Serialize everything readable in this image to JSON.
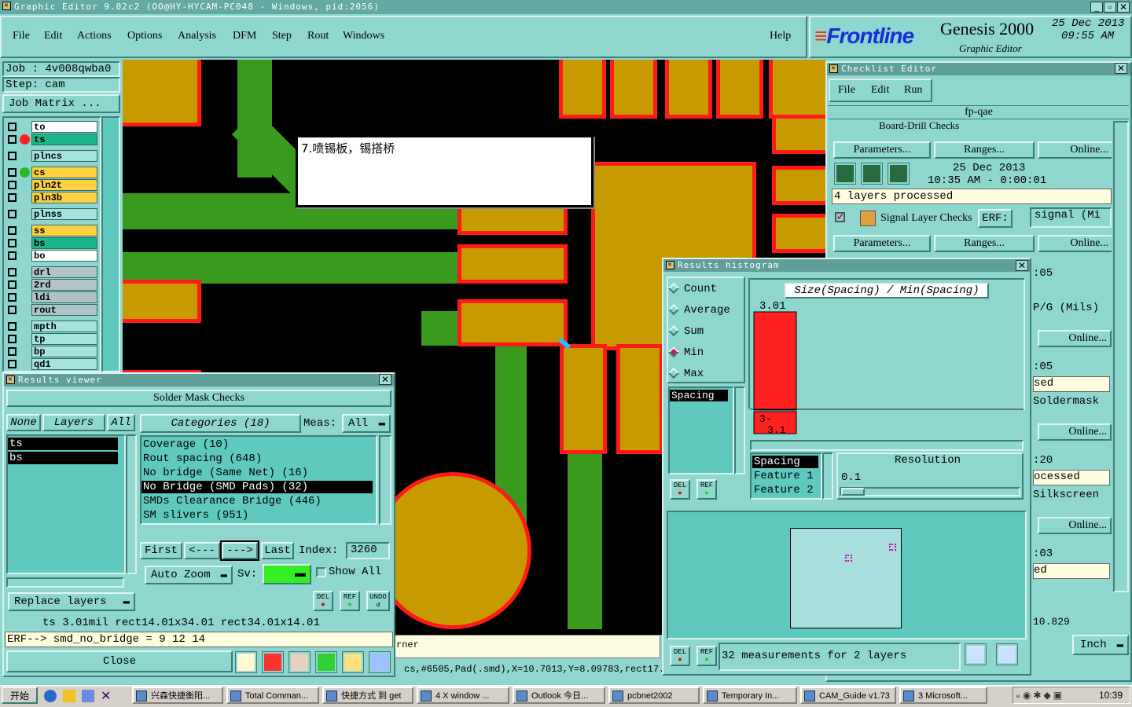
{
  "window": {
    "title": "Graphic Editor 9.02c2  (OO@HY-HYCAM-PC048 - Windows, pid:2056)"
  },
  "menubar": {
    "items": [
      "File",
      "Edit",
      "Actions",
      "Options",
      "Analysis",
      "DFM",
      "Step",
      "Rout",
      "Windows"
    ],
    "help": "Help"
  },
  "brand": {
    "logo": "Frontline",
    "product": "Genesis 2000",
    "subtitle": "Graphic Editor",
    "date": "25 Dec 2013",
    "time": "09:55 AM"
  },
  "job": {
    "job": "Job  :  4v008qwba0",
    "step": "Step:  cam",
    "matrix_button": "Job Matrix ..."
  },
  "layers": [
    {
      "name": "to",
      "style": "w",
      "dot": ""
    },
    {
      "name": "ts",
      "style": "g",
      "dot": "#ff2020"
    },
    {
      "name": "plncs",
      "style": "c",
      "dot": ""
    },
    {
      "name": "cs",
      "style": "y",
      "dot": "#28b828"
    },
    {
      "name": "pln2t",
      "style": "y",
      "dot": ""
    },
    {
      "name": "pln3b",
      "style": "y",
      "dot": ""
    },
    {
      "name": "plnss",
      "style": "c",
      "dot": ""
    },
    {
      "name": "ss",
      "style": "y",
      "dot": ""
    },
    {
      "name": "bs",
      "style": "g",
      "dot": ""
    },
    {
      "name": "bo",
      "style": "w",
      "dot": ""
    },
    {
      "name": "drl",
      "style": "s",
      "dot": ""
    },
    {
      "name": "2rd",
      "style": "s",
      "dot": ""
    },
    {
      "name": "ldi",
      "style": "s",
      "dot": ""
    },
    {
      "name": "rout",
      "style": "s",
      "dot": ""
    },
    {
      "name": "mpth",
      "style": "c",
      "dot": ""
    },
    {
      "name": "tp",
      "style": "c",
      "dot": ""
    },
    {
      "name": "bp",
      "style": "c",
      "dot": ""
    },
    {
      "name": "qd1",
      "style": "c",
      "dot": ""
    }
  ],
  "annotation": {
    "text": "7.喷锡板，锡搭桥"
  },
  "status_coords": "cs,#6505,Pad(.smd),X=10.7013,Y=8.09783,rect17.",
  "status_left": "rner",
  "results_viewer": {
    "title": "Results viewer",
    "header": "Solder Mask Checks",
    "none": "None",
    "layers_label": "Layers",
    "all": "All",
    "layer_items": [
      "ts",
      "bs"
    ],
    "categories_label": "Categories (18)",
    "meas_label": "Meas:",
    "meas_value": "All",
    "categories": [
      "Coverage (10)",
      "Rout spacing (648)",
      "No bridge (Same Net) (16)",
      "No Bridge (SMD Pads) (32)",
      "SMDs Clearance Bridge (446)",
      "SM slivers (951)"
    ],
    "selected_category": 3,
    "first": "First",
    "prev": "<---",
    "next": "--->",
    "last": "Last",
    "index_label": "Index:",
    "index_value": "3260",
    "auto_zoom": "Auto Zoom",
    "sv_label": "Sv:",
    "show_all": "Show All",
    "replace_layers": "Replace layers",
    "del": "DEL",
    "ref": "REF",
    "undo": "UNDO",
    "info1": "ts 3.01mil   rect14.01x34.01   rect34.01x14.01",
    "info2": "ERF--> smd_no_bridge = 9 12 14",
    "close": "Close"
  },
  "checklist": {
    "title": "Checklist Editor",
    "menu": [
      "File",
      "Edit",
      "Run"
    ],
    "name": "fp-qae",
    "row0": "Board-Drill Checks",
    "erf": "ERF:",
    "params": "Parameters...",
    "ranges": "Ranges...",
    "online": "Online...",
    "date": "25 Dec 2013",
    "time": "10:35 AM - 0:00:01",
    "processed": "4 layers processed",
    "signal_row": "Signal Layer Checks",
    "signal_val": "signal (Mi",
    "side_items": [
      ":05",
      "P/G (Mils)",
      ":05",
      "sed",
      "Soldermask",
      ":20",
      "ocessed",
      "Silkscreen",
      ":03",
      "ed"
    ],
    "bottom_val": "10.829250",
    "units": "Inch"
  },
  "histogram": {
    "title": "Results histogram",
    "options": [
      "Count",
      "Average",
      "Sum",
      "Min",
      "Max"
    ],
    "selected": "Min",
    "chart_title": "Size(Spacing) / Min(Spacing)",
    "bar_value": "3.01",
    "bar_label": "3-\n3.1",
    "list": [
      "Spacing"
    ],
    "feature_list": [
      "Spacing",
      "Feature 1",
      "Feature 2"
    ],
    "resolution_label": "Resolution",
    "resolution_value": "0.1",
    "footer": "32 measurements for 2 layers"
  },
  "chart_data": {
    "type": "bar",
    "title": "Size(Spacing) / Min(Spacing)",
    "categories": [
      "3-3.1"
    ],
    "values": [
      3.01
    ]
  },
  "taskbar": {
    "start": "开始",
    "items": [
      "兴森快捷衡阳...",
      "Total Comman...",
      "快捷方式 到 get",
      "4 X window ...",
      "Outlook 今日...",
      "pcbnet2002",
      "Temporary In...",
      "CAM_Guide v1.73",
      "3 Microsoft..."
    ],
    "clock": "10:39"
  }
}
